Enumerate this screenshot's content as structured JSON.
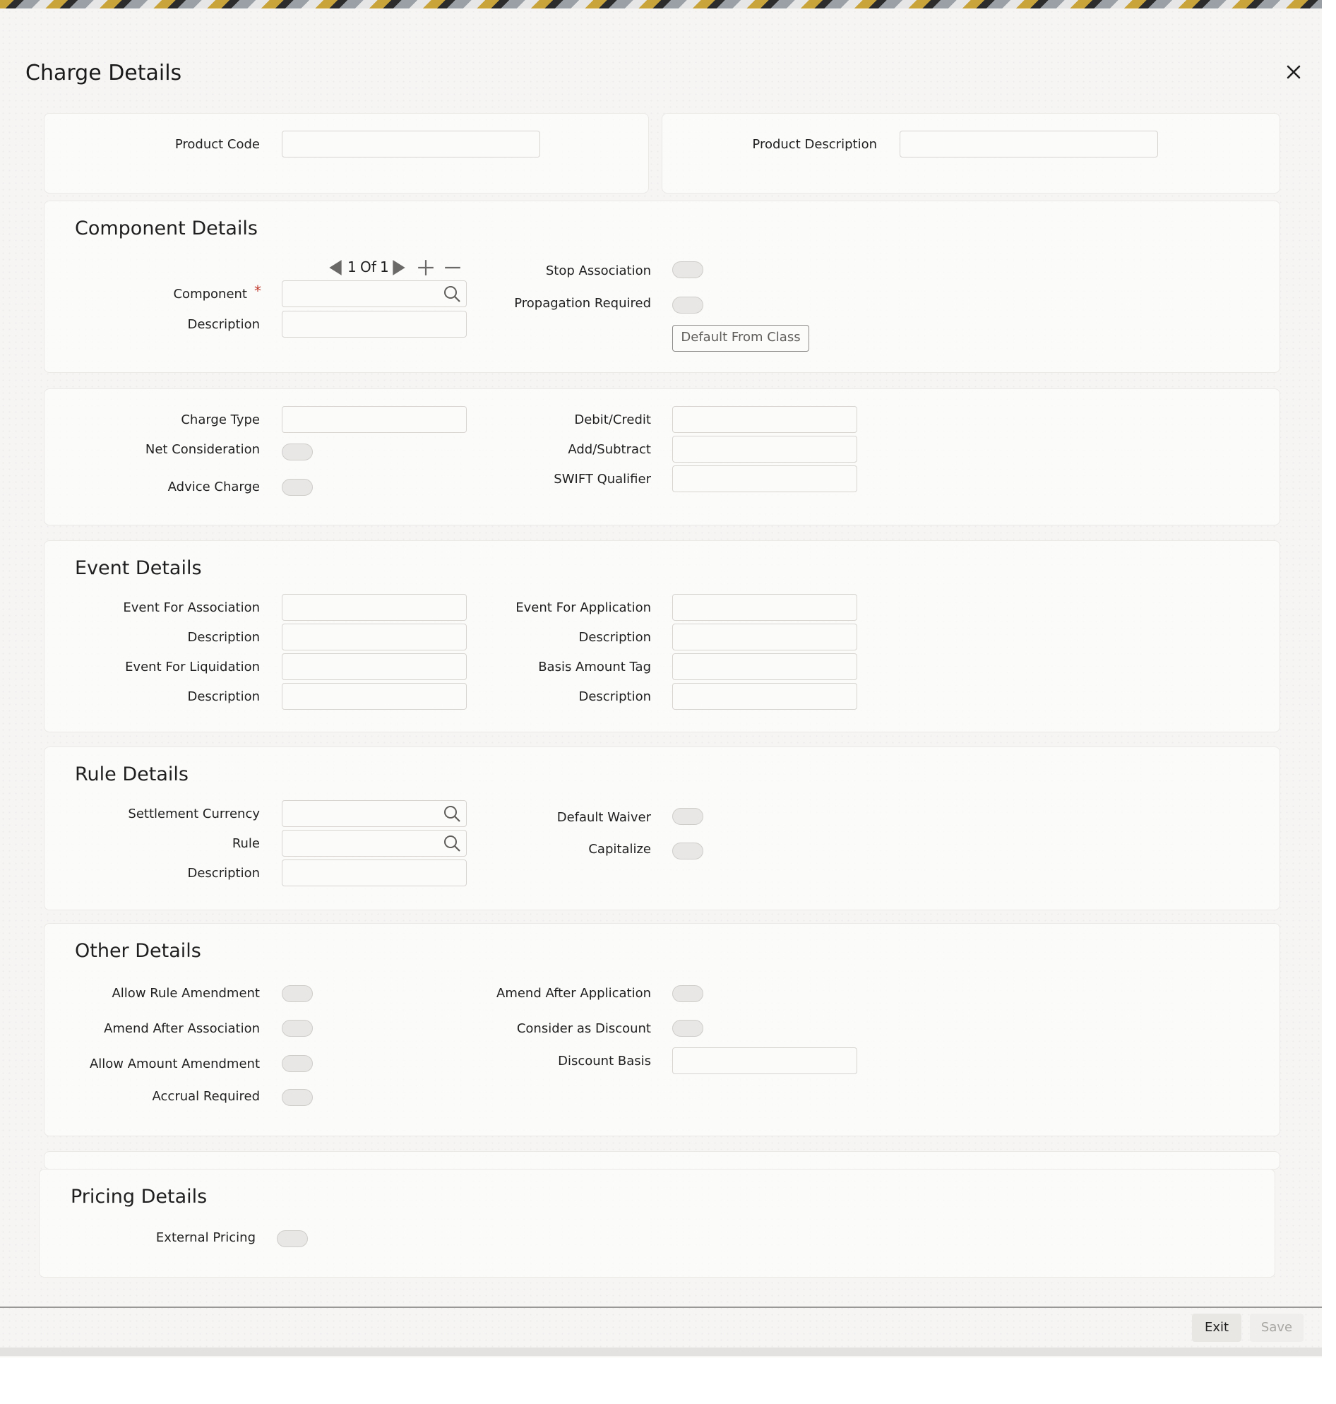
{
  "window": {
    "title": "Charge Details"
  },
  "header": {
    "product_code_label": "Product Code",
    "product_code_value": "",
    "product_description_label": "Product Description",
    "product_description_value": ""
  },
  "component_details": {
    "heading": "Component Details",
    "pager": {
      "current": "1",
      "of_label": "Of",
      "total": "1"
    },
    "component_label": "Component",
    "required_mark": "*",
    "component_value": "",
    "description_label": "Description",
    "description_value": "",
    "stop_association_label": "Stop Association",
    "propagation_required_label": "Propagation Required",
    "default_from_class_label": "Default From Class"
  },
  "charge": {
    "charge_type_label": "Charge Type",
    "net_consideration_label": "Net Consideration",
    "advice_charge_label": "Advice Charge",
    "debit_credit_label": "Debit/Credit",
    "add_subtract_label": "Add/Subtract",
    "swift_qualifier_label": "SWIFT Qualifier"
  },
  "event_details": {
    "heading": "Event Details",
    "event_for_association_label": "Event For Association",
    "description1_label": "Description",
    "event_for_liquidation_label": "Event For Liquidation",
    "description2_label": "Description",
    "event_for_application_label": "Event For Application",
    "description3_label": "Description",
    "basis_amount_tag_label": "Basis Amount Tag",
    "description4_label": "Description"
  },
  "rule_details": {
    "heading": "Rule Details",
    "settlement_currency_label": "Settlement Currency",
    "rule_label": "Rule",
    "description_label": "Description",
    "default_waiver_label": "Default Waiver",
    "capitalize_label": "Capitalize"
  },
  "other_details": {
    "heading": "Other Details",
    "allow_rule_amendment_label": "Allow Rule Amendment",
    "amend_after_association_label": "Amend After Association",
    "allow_amount_amendment_label": "Allow Amount Amendment",
    "accrual_required_label": "Accrual Required",
    "amend_after_application_label": "Amend After Application",
    "consider_as_discount_label": "Consider as Discount",
    "discount_basis_label": "Discount Basis"
  },
  "pricing_details": {
    "heading": "Pricing Details",
    "external_pricing_label": "External Pricing"
  },
  "footer": {
    "exit_label": "Exit",
    "save_label": "Save"
  },
  "icons": {
    "close": "close-icon",
    "search": "search-icon",
    "prev": "triangle-left-icon",
    "next": "triangle-right-icon",
    "add": "plus-icon",
    "remove": "minus-icon"
  },
  "colors": {
    "accent_required": "#c0392b",
    "panel_bg": "#fcfcfb"
  }
}
